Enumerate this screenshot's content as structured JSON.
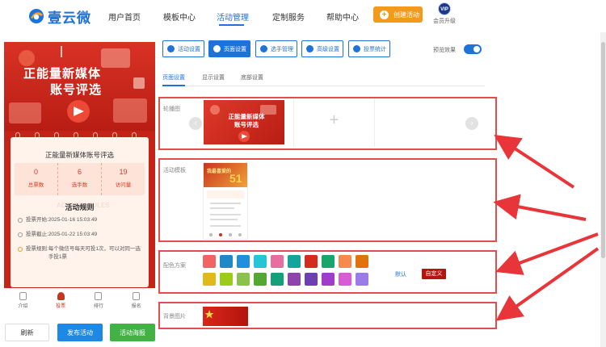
{
  "brand": {
    "name": "壹云微",
    "accent": "#1e73d9",
    "highlight": "#e74c4c"
  },
  "nav": {
    "items": [
      {
        "label": "用户首页",
        "active": false
      },
      {
        "label": "模板中心",
        "active": false
      },
      {
        "label": "活动管理",
        "active": true
      },
      {
        "label": "定制服务",
        "active": false
      },
      {
        "label": "帮助中心",
        "active": false
      }
    ],
    "create_button": "创建活动",
    "vip_badge": "VIP",
    "vip_label": "会员升级"
  },
  "preview": {
    "hero_line1": "正能量新媒体",
    "hero_line2": "账号评选",
    "card_title": "正能量新媒体账号评选",
    "stats": [
      {
        "value": "0",
        "label": "总票数"
      },
      {
        "value": "6",
        "label": "选手数"
      },
      {
        "value": "19",
        "label": "访问量"
      }
    ],
    "rules_ghost": "ACTIVITY RULES",
    "rules_title": "活动规则",
    "rules": [
      {
        "label": "投票开始: ",
        "value": "2025-01-16 15:03:49"
      },
      {
        "label": "投票截止: ",
        "value": "2025-01-22 15:03:49"
      },
      {
        "label": "投票规则: ",
        "value": "每个微信号每天可投1次，可以对同一选手投1票"
      }
    ],
    "bottom_tabs": [
      "介绍",
      "投票",
      "排行",
      "报名"
    ]
  },
  "actions": {
    "refresh": "刷新",
    "publish": "发布活动",
    "poster": "活动海报"
  },
  "toolbar": {
    "buttons": [
      "活动设置",
      "页面设置",
      "选手管理",
      "高级设置",
      "投票统计"
    ],
    "preview_effect": "预览效果"
  },
  "subtabs": [
    "页面设置",
    "显示设置",
    "底部设置"
  ],
  "sections": {
    "carousel_label": "轮播图",
    "carousel_thumb_line1": "正能量新媒体",
    "carousel_thumb_line2": "账号评选",
    "carousel_add": "+",
    "template_label": "活动模板",
    "template_thumb_title": "我最喜爱的",
    "color_label": "配色方案",
    "color_default": "默认",
    "color_custom": "自定义",
    "background_label": "背景图片"
  },
  "colors_row1": [
    "#f06464",
    "#1e88c9",
    "#1f8fe0",
    "#25c4d6",
    "#e86ea2",
    "#14a49b",
    "#d42b1e",
    "#1aa56c",
    "#f58a4a",
    "#e0730c"
  ],
  "colors_row2": [
    "#e0b91a",
    "#9ccb1c",
    "#8bc34a",
    "#52a832",
    "#16a07a",
    "#8e44ad",
    "#6c3fb5",
    "#a03cc9",
    "#d95bd6",
    "#9b7be8"
  ]
}
